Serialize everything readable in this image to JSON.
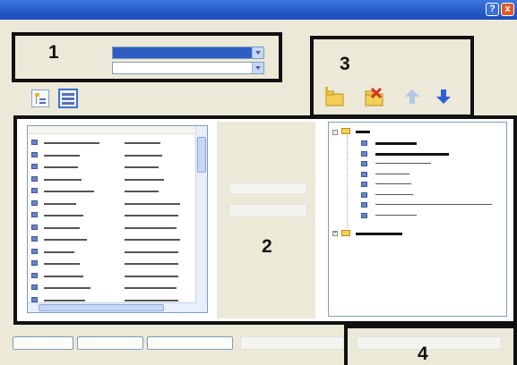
{
  "titlebar": {
    "help_icon": "?",
    "close_icon": "x"
  },
  "callouts": [
    "1",
    "2",
    "3",
    "4"
  ],
  "toolbar": {
    "icons": [
      "new-folder-icon",
      "delete-folder-icon",
      "move-up-icon",
      "move-down-icon"
    ]
  },
  "colors": {
    "accent": "#2f5fc4",
    "callout": "#111111",
    "folder": "#f3cf58"
  }
}
